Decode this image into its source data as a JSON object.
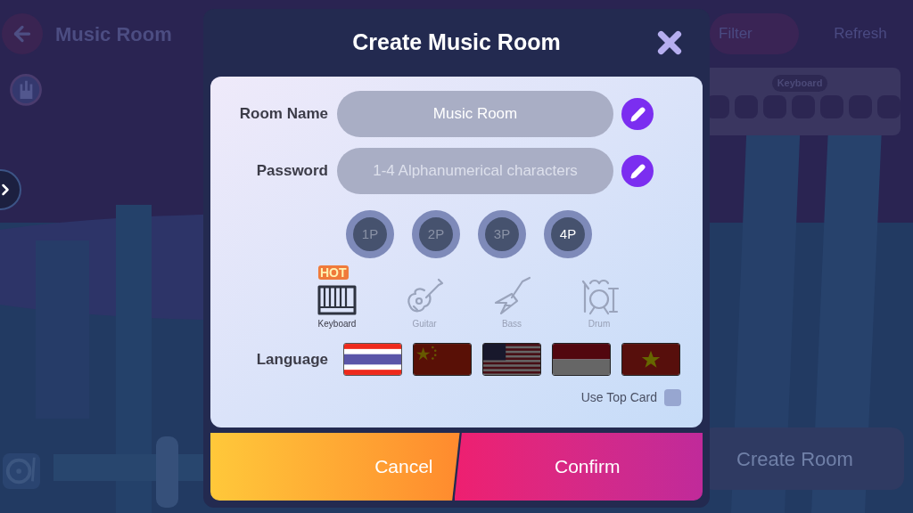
{
  "background": {
    "title": "Music Room",
    "filter_button": "Filter",
    "refresh_button": "Refresh",
    "instrument_chip": "Keyboard",
    "create_button": "Create Room"
  },
  "dialog": {
    "title": "Create Music Room",
    "fields": [
      {
        "label": "Room Name",
        "value": "Music Room"
      },
      {
        "label": "Password",
        "placeholder": "1-4 Alphanumerical characters"
      }
    ],
    "players": [
      {
        "label": "1P",
        "selected": false
      },
      {
        "label": "2P",
        "selected": false
      },
      {
        "label": "3P",
        "selected": false
      },
      {
        "label": "4P",
        "selected": true
      }
    ],
    "instruments": [
      {
        "label": "Keyboard",
        "kind": "keyboard",
        "selected": true,
        "badge": "HOT"
      },
      {
        "label": "Guitar",
        "kind": "guitar",
        "selected": false
      },
      {
        "label": "Bass",
        "kind": "bass",
        "selected": false
      },
      {
        "label": "Drum",
        "kind": "drum",
        "selected": false
      }
    ],
    "language": {
      "label": "Language",
      "flags": [
        {
          "kind": "thailand",
          "selected": true
        },
        {
          "kind": "china",
          "selected": false
        },
        {
          "kind": "usa",
          "selected": false
        },
        {
          "kind": "indonesia",
          "selected": false
        },
        {
          "kind": "vietnam",
          "selected": false
        }
      ]
    },
    "use_top_card": {
      "label": "Use Top Card",
      "checked": false
    },
    "buttons": [
      {
        "label": "Cancel",
        "kind": "cancel"
      },
      {
        "label": "Confirm",
        "kind": "confirm"
      }
    ]
  }
}
